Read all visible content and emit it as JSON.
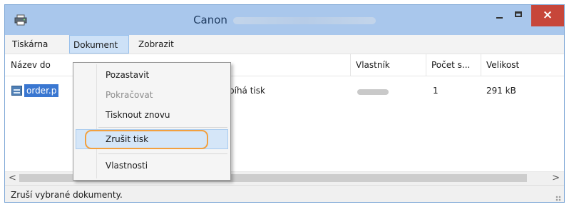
{
  "window": {
    "title": "Canon",
    "buttons": {
      "close_glyph": "×"
    }
  },
  "menubar": {
    "items": [
      {
        "label": "Tiskárna"
      },
      {
        "label": "Dokument",
        "active": true
      },
      {
        "label": "Zobrazit"
      }
    ]
  },
  "columns": {
    "nazev": "Název do",
    "vlastnik": "Vlastník",
    "pocet": "Počet s...",
    "velikost": "Velikost"
  },
  "rows": [
    {
      "name": "order.p",
      "status": "bíhá tisk",
      "pages": "1",
      "size": "291 kB"
    }
  ],
  "dropdown": {
    "items": [
      {
        "label": "Pozastavit",
        "enabled": true
      },
      {
        "label": "Pokračovat",
        "enabled": false
      },
      {
        "label": "Tisknout znovu",
        "enabled": true
      },
      {
        "label": "Zrušit tisk",
        "enabled": true,
        "highlighted": true
      },
      {
        "label": "Vlastnosti",
        "enabled": true
      }
    ]
  },
  "scrollbar": {
    "left_arrow": "<",
    "right_arrow": ">"
  },
  "statusbar": {
    "text": "Zruší vybrané dokumenty."
  },
  "colors": {
    "titlebar": "#a9c7ec",
    "close_button": "#c7463a",
    "selection": "#3a77d1",
    "callout": "#f2a03f"
  },
  "icons": [
    "printer-icon",
    "minimize-icon",
    "maximize-icon",
    "close-icon",
    "document-icon"
  ]
}
